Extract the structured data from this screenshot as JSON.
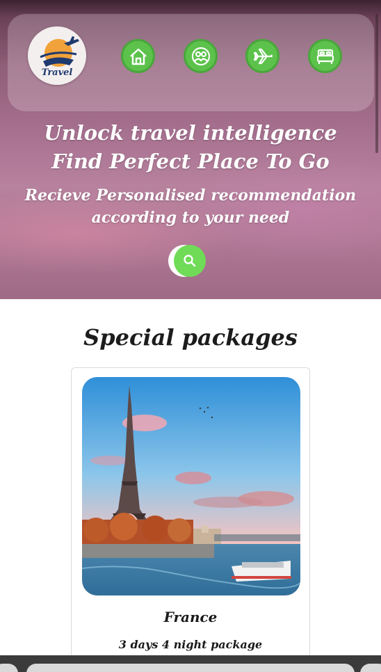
{
  "header": {
    "logo_text": "Travel",
    "nav_icons": [
      "home-icon",
      "users-icon",
      "airplane-icon",
      "bed-icon"
    ]
  },
  "hero": {
    "line1": "Unlock travel intelligence",
    "line2": "Find Perfect Place To Go",
    "tagline": "Recieve Personalised recommendation according to your need",
    "search_icon": "search-icon"
  },
  "packages": {
    "title": "Special packages",
    "cards": [
      {
        "name": "France",
        "description": "3 days 4 night package"
      }
    ]
  },
  "colors": {
    "accent_green": "#5cc24b",
    "search_green": "#6fdb57",
    "hero_pink": "#b7829e"
  }
}
